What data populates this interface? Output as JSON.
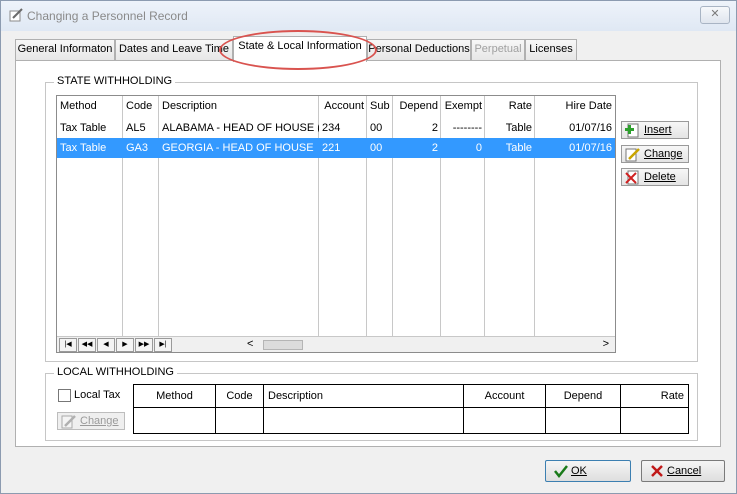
{
  "window": {
    "title": "Changing a Personnel Record",
    "close_label": "✕"
  },
  "tabs": [
    {
      "label": "General Informaton",
      "state": "normal"
    },
    {
      "label": "Dates and Leave Time",
      "state": "normal"
    },
    {
      "label": "State & Local Information",
      "state": "active"
    },
    {
      "label": "Personal Deductions",
      "state": "normal"
    },
    {
      "label": "Perpetual",
      "state": "disabled"
    },
    {
      "label": "Licenses",
      "state": "normal"
    }
  ],
  "state_withholding": {
    "label": "STATE WITHHOLDING",
    "columns": [
      "Method",
      "Code",
      "Description",
      "Account",
      "Sub",
      "Depend",
      "Exempt",
      "Rate",
      "Hire Date"
    ],
    "rows": [
      {
        "method": "Tax Table",
        "code": "AL5",
        "description": "ALABAMA - HEAD OF HOUSE (I",
        "account": "234",
        "sub": "00",
        "depend": "2",
        "exempt": "--------",
        "rate": "Table",
        "hire_date": "01/07/16",
        "selected": false
      },
      {
        "method": "Tax Table",
        "code": "GA3",
        "description": "GEORGIA - HEAD OF HOUSE",
        "account": "221",
        "sub": "00",
        "depend": "2",
        "exempt": "0",
        "rate": "Table",
        "hire_date": "01/07/16",
        "selected": true
      }
    ],
    "nav_buttons": [
      "|◀",
      "◀◀",
      "◀",
      "▶",
      "▶▶",
      "▶|"
    ],
    "scroll_left": "<",
    "scroll_right": ">",
    "buttons": {
      "insert": "Insert",
      "change": "Change",
      "delete": "Delete"
    }
  },
  "local_withholding": {
    "label": "LOCAL WITHHOLDING",
    "local_tax_label": "Local Tax",
    "local_tax_checked": false,
    "change_label": "Change",
    "columns": [
      "Method",
      "Code",
      "Description",
      "Account",
      "Depend",
      "Rate"
    ]
  },
  "footer": {
    "ok_label": "OK",
    "cancel_label": "Cancel"
  },
  "colors": {
    "selection": "#3399ff",
    "highlight_ring": "#d9534f"
  }
}
